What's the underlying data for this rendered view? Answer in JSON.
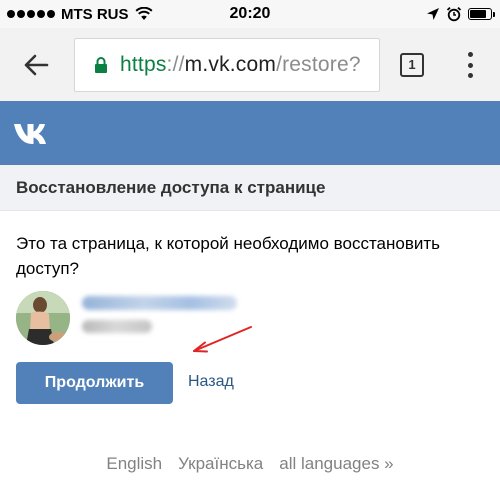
{
  "status_bar": {
    "carrier": "MTS RUS",
    "time": "20:20",
    "battery_level": 0.8
  },
  "browser": {
    "url_scheme": "https",
    "url_sep": "://",
    "url_host": "m.vk.com",
    "url_path": "/restore?",
    "tab_count": "1",
    "icons": [
      "back-arrow-icon",
      "lock-icon",
      "tabs-icon",
      "overflow-menu-icon"
    ]
  },
  "vk": {
    "logo": "VK",
    "brand_color": "#5181b8"
  },
  "page": {
    "title": "Восстановление доступа к странице",
    "question": "Это та страница, к которой необходимо восстановить доступ?",
    "continue_label": "Продолжить",
    "back_label": "Назад"
  },
  "footer": {
    "languages": [
      "English",
      "Українська",
      "all languages »"
    ]
  }
}
